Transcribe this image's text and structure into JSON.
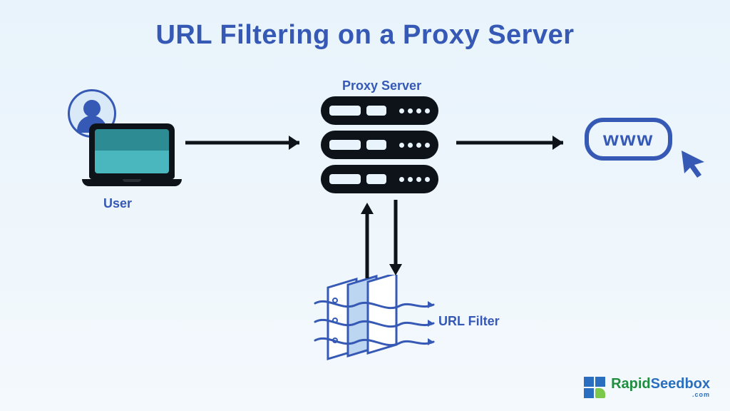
{
  "title": "URL Filtering on a Proxy Server",
  "nodes": {
    "user": {
      "label": "User"
    },
    "proxy": {
      "label": "Proxy Server"
    },
    "filter": {
      "label": "URL Filter"
    },
    "web": {
      "label": "www"
    }
  },
  "brand": {
    "name_a": "Rapid",
    "name_b": "Seedbox",
    "tld": ".com"
  },
  "colors": {
    "accent": "#3559b5",
    "ink": "#0e1219",
    "bg_top": "#e8f3fb",
    "bg_bot": "#f4f9fd",
    "brand_green": "#1f8f3f",
    "brand_blue": "#2a6fbf"
  }
}
